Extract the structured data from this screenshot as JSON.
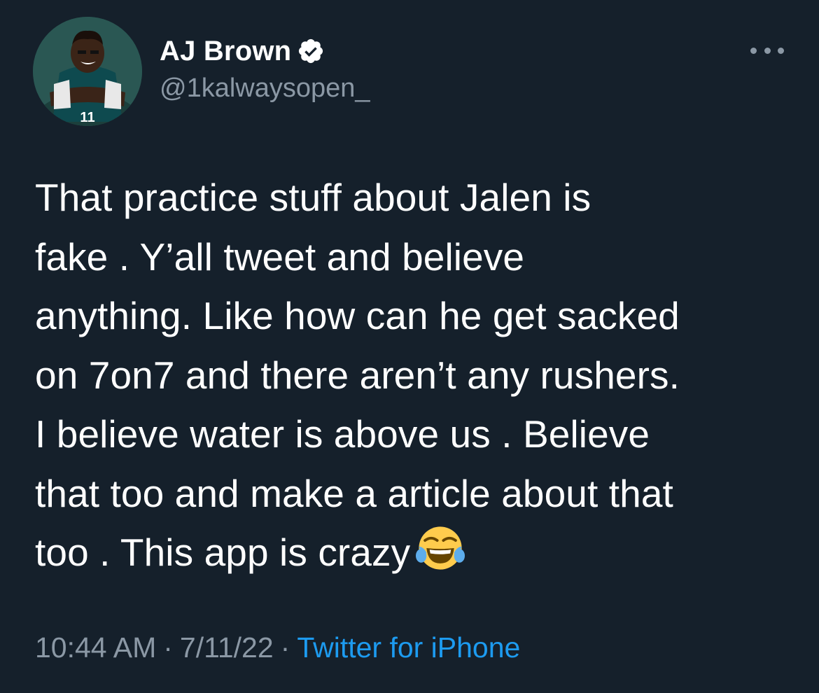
{
  "tweet": {
    "display_name": "AJ Brown",
    "handle": "@1kalwaysopen_",
    "verified": true,
    "more_icon": "ellipsis-icon",
    "text": "That practice stuff about Jalen is\nfake . Y’all tweet and believe\nanything. Like how can he get sacked\non 7on7 and there aren’t any rushers.\nI believe water is above us . Believe\nthat too and make a article about that\ntoo . This app is crazy",
    "emoji": "😂",
    "time": "10:44 AM",
    "date": "7/11/22",
    "separator": "·",
    "source": "Twitter for iPhone"
  },
  "colors": {
    "background": "#15202b",
    "text": "#ffffff",
    "secondary": "#8b98a5",
    "link": "#1d9bf0"
  }
}
